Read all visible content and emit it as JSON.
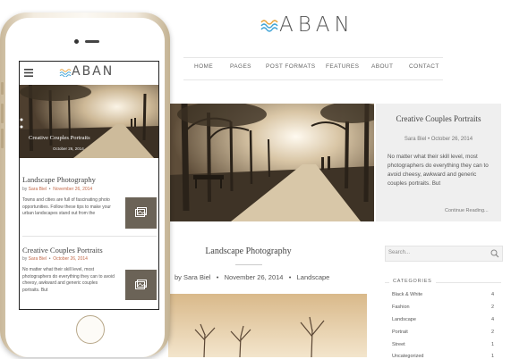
{
  "brand": {
    "name": "ABAN"
  },
  "nav": {
    "items": [
      "HOME",
      "PAGES",
      "POST FORMATS",
      "FEATURES",
      "ABOUT",
      "CONTACT"
    ]
  },
  "featured": {
    "title": "Creative Couples Portraits",
    "author": "Sara Biel",
    "date": "October 26, 2014",
    "excerpt": "No matter what their skill level, most photographers do everything they can to avoid cheesy, awkward and generic couples portraits. But",
    "more": "Continue Reading..."
  },
  "post": {
    "title": "Landscape Photography",
    "by": "by",
    "author": "Sara Biel",
    "date": "November 26, 2014",
    "category": "Landscape"
  },
  "sidebar": {
    "search_placeholder": "Search...",
    "categories_title": "CATEGORIES",
    "categories": [
      {
        "name": "Black & White",
        "count": "4"
      },
      {
        "name": "Fashion",
        "count": "2"
      },
      {
        "name": "Landscape",
        "count": "4"
      },
      {
        "name": "Portrait",
        "count": "2"
      },
      {
        "name": "Street",
        "count": "1"
      },
      {
        "name": "Uncategorized",
        "count": "1"
      }
    ]
  },
  "mobile": {
    "hero_title": "Creative Couples Portraits",
    "hero_date": "October 26, 2014",
    "posts": [
      {
        "title": "Landscape Photography",
        "by": "by",
        "author": "Sara Biel",
        "date": "November 26, 2014",
        "excerpt": "Towns and cities are full of fascinating photo opportunities. Follow these tips to make your urban landscapes stand out from the"
      },
      {
        "title": "Creative Couples Portraits",
        "by": "by",
        "author": "Sara Biel",
        "date": "October 26, 2014",
        "excerpt": "No matter what their skill level, most photographers do everything they can to avoid cheesy, awkward and generic couples portraits. But"
      }
    ]
  },
  "colors": {
    "accent": "#c46a4a",
    "sepia": "#8a7356",
    "wave_blue": "#3ea3d6",
    "wave_orange": "#e6a23c"
  }
}
